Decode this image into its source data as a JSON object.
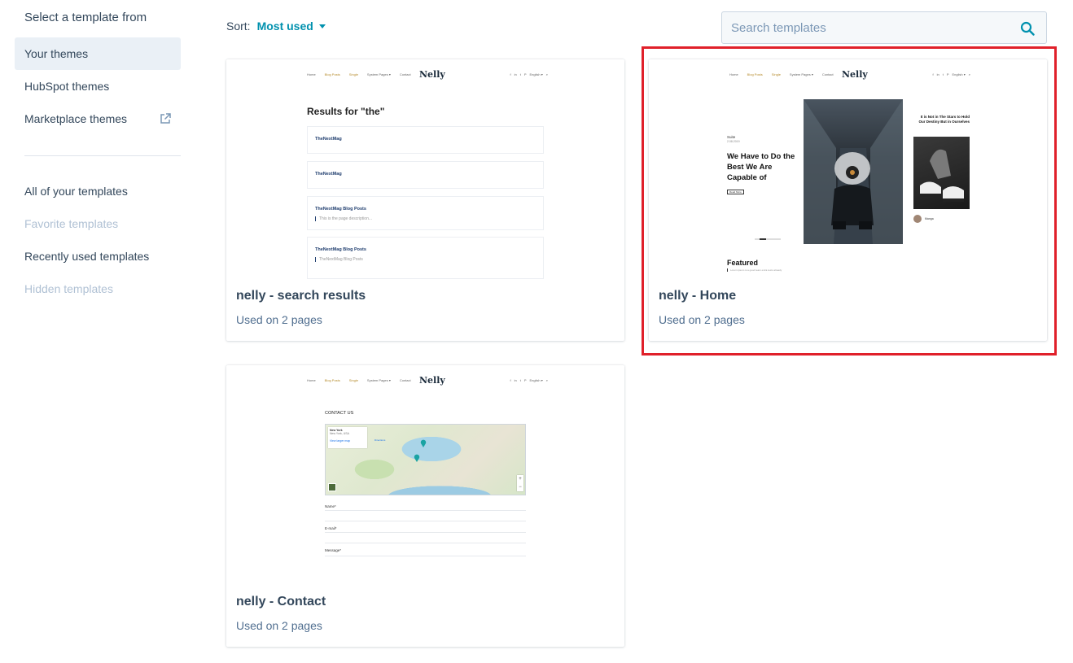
{
  "sidebar": {
    "heading": "Select a template from",
    "theme_items": [
      {
        "label": "Your themes",
        "active": true
      },
      {
        "label": "HubSpot themes"
      },
      {
        "label": "Marketplace themes",
        "icon": "external-link-icon"
      }
    ],
    "filter_items": [
      {
        "label": "All of your templates"
      },
      {
        "label": "Favorite templates",
        "disabled": true
      },
      {
        "label": "Recently used templates"
      },
      {
        "label": "Hidden templates",
        "disabled": true
      }
    ]
  },
  "toolbar": {
    "sort_label": "Sort:",
    "sort_value": "Most used",
    "search_placeholder": "Search templates"
  },
  "preview_common": {
    "nav_links": [
      "Home",
      "Blog Posts",
      "Single",
      "System Pages ▾",
      "Contact"
    ],
    "logo": "Nelly",
    "nav_right": [
      "f",
      "in",
      "t",
      "P",
      "English ▾",
      "⌕"
    ]
  },
  "cards": [
    {
      "title": "nelly - search results",
      "usage": "Used on 2 pages",
      "preview": {
        "heading": "Results for \"the\"",
        "results": [
          {
            "title": "TheNextMag",
            "sub": ""
          },
          {
            "title": "TheNextMag",
            "sub": ""
          },
          {
            "title": "TheNextMag Blog Posts",
            "sub": "This is the page description..."
          },
          {
            "title": "TheNextMag Blog Posts",
            "sub": "TheNextMag Blog Posts"
          }
        ]
      }
    },
    {
      "title": "nelly - Home",
      "usage": "Used on 2 pages",
      "selected": true,
      "preview": {
        "kicker": "Suite",
        "date": "2.08.2019",
        "headline": "We Have to Do the Best We Are Capable of",
        "button": "Read More",
        "side_title": "It is Not in The Stars to Hold Our Destiny But in Ourselves",
        "author": "Manga",
        "featured": "Featured",
        "featured_sub": "Lorem ipsum is a good team extra texts already"
      }
    },
    {
      "title": "nelly - Contact",
      "usage": "Used on 2 pages",
      "preview": {
        "heading": "CONTACT US",
        "map_place": "New York",
        "map_sub": "New York, USA",
        "map_link": "View larger map",
        "map_dir": "Directions",
        "fields": [
          "Name*",
          "E-mail*",
          "Message*"
        ]
      }
    }
  ],
  "colors": {
    "accent": "#0091ae",
    "text": "#33475b",
    "active_bg": "#eaf0f6",
    "disabled": "#b0c1d4",
    "highlight": "#e0202a"
  }
}
